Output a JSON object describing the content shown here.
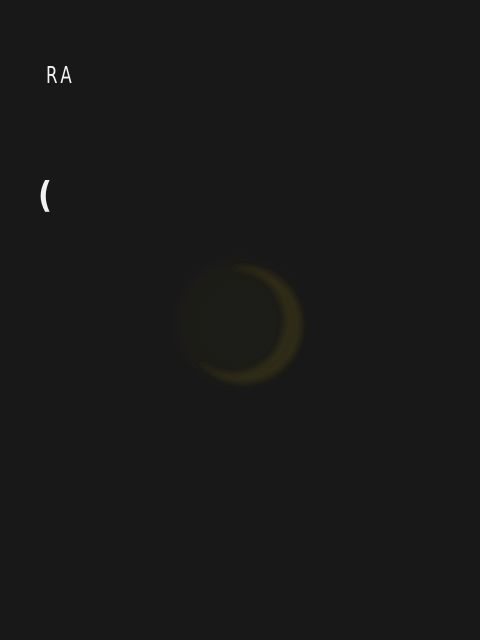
{
  "header": {
    "brand_text": "RA"
  },
  "content": {
    "partial_text": "("
  },
  "loader": {
    "icon": "loading-crescent-icon",
    "accent_color": "#2b2a1a",
    "background_color": "#181818"
  }
}
